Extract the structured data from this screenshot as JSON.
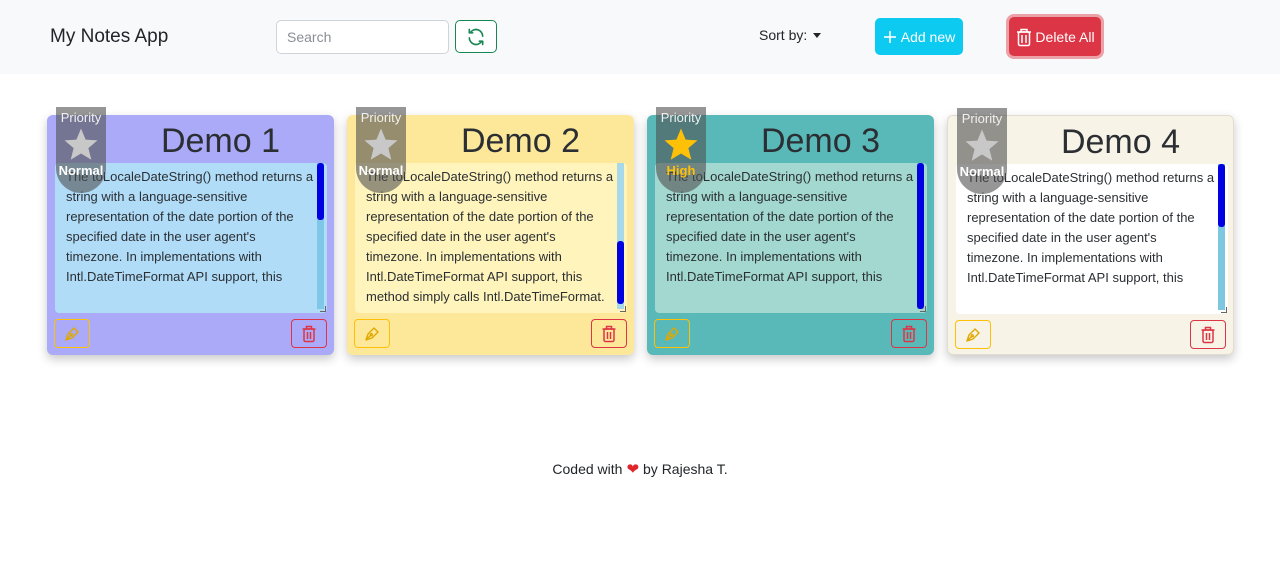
{
  "navbar": {
    "brand": "My Notes App",
    "search_placeholder": "Search",
    "refresh_icon": "refresh-icon",
    "sort_label": "Sort by:",
    "add_label": "Add new",
    "delete_all_label": "Delete All"
  },
  "priority_label": "Priority",
  "notes": [
    {
      "title": "Demo 1",
      "priority": "Normal",
      "text": "The toLocaleDateString() method returns a string with a language-sensitive representation of the date portion of the specified date in the user agent's timezone. In implementations with Intl.DateTimeFormat API support, this",
      "card_color": "#aaaaf8",
      "body_color": "#b0dcf8"
    },
    {
      "title": "Demo 2",
      "priority": "Normal",
      "text": "The toLocaleDateString() method returns a string with a language-sensitive representation of the date portion of the specified date in the user agent's timezone. In implementations with Intl.DateTimeFormat API support, this method simply calls Intl.DateTimeFormat.",
      "card_color": "#fde89a",
      "body_color": "#fff4bb"
    },
    {
      "title": "Demo 3",
      "priority": "High",
      "text": "The toLocaleDateString() method returns a string with a language-sensitive representation of the date portion of the specified date in the user agent's timezone. In implementations with Intl.DateTimeFormat API support, this",
      "card_color": "#58b9b8",
      "body_color": "#a2d8d0"
    },
    {
      "title": "Demo 4",
      "priority": "Normal",
      "text": "The toLocaleDateString() method returns a string with a language-sensitive representation of the date portion of the specified date in the user agent's timezone. In implementations with Intl.DateTimeFormat API support, this",
      "card_color": "#f7f3e6",
      "body_color": "#ffffff"
    }
  ],
  "footer": {
    "prefix": "Coded with",
    "suffix": "by Rajesha T."
  }
}
